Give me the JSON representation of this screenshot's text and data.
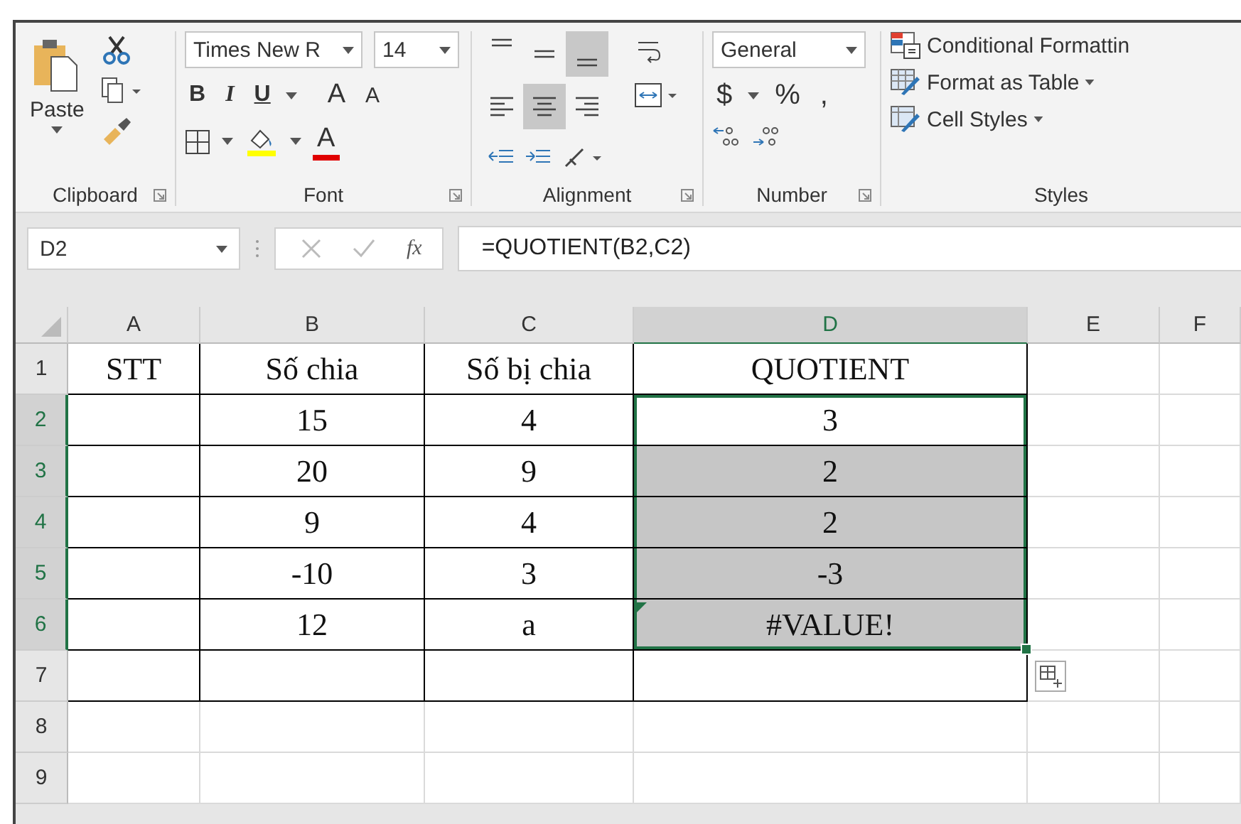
{
  "ribbon": {
    "clipboard": {
      "label": "Clipboard",
      "paste": "Paste"
    },
    "font": {
      "label": "Font",
      "font_name": "Times New R",
      "font_size": "14",
      "bold": "B",
      "italic": "I",
      "underline": "U",
      "grow": "A",
      "shrink": "A",
      "color_letter": "A"
    },
    "alignment": {
      "label": "Alignment",
      "buttons": [
        {
          "kind": "top",
          "selected": false
        },
        {
          "kind": "middle",
          "selected": false
        },
        {
          "kind": "bottom",
          "selected": true
        },
        {
          "kind": "left",
          "selected": false
        },
        {
          "kind": "center",
          "selected": true
        },
        {
          "kind": "right",
          "selected": false
        }
      ]
    },
    "number": {
      "label": "Number",
      "format": "General",
      "currency": "$",
      "percent": "%",
      "comma": ","
    },
    "styles": {
      "label": "Styles",
      "items": [
        {
          "kind": "conditional",
          "label": "Conditional Formattin",
          "dropdown": false
        },
        {
          "kind": "table",
          "label": "Format as Table",
          "dropdown": true
        },
        {
          "kind": "cellstyles",
          "label": "Cell Styles",
          "dropdown": true
        }
      ]
    }
  },
  "formula_bar": {
    "name_box": "D2",
    "fx": "fx",
    "formula": "=QUOTIENT(B2,C2)"
  },
  "sheet": {
    "columns": [
      {
        "label": "A",
        "selected": false,
        "bordered": true
      },
      {
        "label": "B",
        "selected": false,
        "bordered": true
      },
      {
        "label": "C",
        "selected": false,
        "bordered": true
      },
      {
        "label": "D",
        "selected": true,
        "bordered": true
      },
      {
        "label": "E",
        "selected": false,
        "bordered": false
      },
      {
        "label": "F",
        "selected": false,
        "bordered": false
      }
    ],
    "rows": [
      {
        "label": "1",
        "selected": false,
        "active": false,
        "bordered": true,
        "cells": [
          {
            "text": "STT",
            "error": false
          },
          {
            "text": "Số chia",
            "error": false
          },
          {
            "text": "Số bị chia",
            "error": false
          },
          {
            "text": "QUOTIENT",
            "error": false
          },
          {
            "error": false
          },
          {
            "error": false
          }
        ]
      },
      {
        "label": "2",
        "selected": true,
        "active": true,
        "bordered": true,
        "cells": [
          {
            "error": false
          },
          {
            "text": "15",
            "error": false
          },
          {
            "text": "4",
            "error": false
          },
          {
            "text": "3",
            "error": false
          },
          {
            "error": false
          },
          {
            "error": false
          }
        ]
      },
      {
        "label": "3",
        "selected": true,
        "active": false,
        "bordered": true,
        "cells": [
          {
            "error": false
          },
          {
            "text": "20",
            "error": false
          },
          {
            "text": "9",
            "error": false
          },
          {
            "text": "2",
            "error": false
          },
          {
            "error": false
          },
          {
            "error": false
          }
        ]
      },
      {
        "label": "4",
        "selected": true,
        "active": false,
        "bordered": true,
        "cells": [
          {
            "error": false
          },
          {
            "text": "9",
            "error": false
          },
          {
            "text": "4",
            "error": false
          },
          {
            "text": "2",
            "error": false
          },
          {
            "error": false
          },
          {
            "error": false
          }
        ]
      },
      {
        "label": "5",
        "selected": true,
        "active": false,
        "bordered": true,
        "cells": [
          {
            "error": false
          },
          {
            "text": "-10",
            "error": false
          },
          {
            "text": "3",
            "error": false
          },
          {
            "text": "-3",
            "error": false
          },
          {
            "error": false
          },
          {
            "error": false
          }
        ]
      },
      {
        "label": "6",
        "selected": true,
        "active": false,
        "bordered": true,
        "cells": [
          {
            "error": false
          },
          {
            "text": "12",
            "error": false
          },
          {
            "text": "a",
            "error": false
          },
          {
            "text": "#VALUE!",
            "error": true
          },
          {
            "error": false
          },
          {
            "error": false
          }
        ]
      },
      {
        "label": "7",
        "selected": false,
        "active": false,
        "bordered": true,
        "cells": [
          {
            "error": false
          },
          {
            "error": false
          },
          {
            "error": false
          },
          {
            "error": false
          },
          {
            "error": false
          },
          {
            "error": false
          }
        ]
      },
      {
        "label": "8",
        "selected": false,
        "active": false,
        "bordered": false,
        "cells": [
          {
            "error": false
          },
          {
            "error": false
          },
          {
            "error": false
          },
          {
            "error": false
          },
          {
            "error": false
          },
          {
            "error": false
          }
        ]
      },
      {
        "label": "9",
        "selected": false,
        "active": false,
        "bordered": false,
        "cells": [
          {
            "error": false
          },
          {
            "error": false
          },
          {
            "error": false
          },
          {
            "error": false
          },
          {
            "error": false
          },
          {
            "error": false
          }
        ]
      }
    ]
  }
}
